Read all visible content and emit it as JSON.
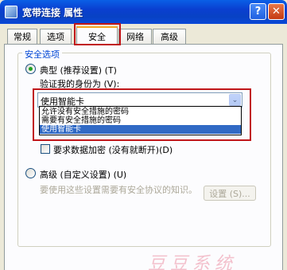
{
  "window": {
    "title": "宽带连接 属性",
    "help_glyph": "?",
    "close_glyph": "✕"
  },
  "tabs": [
    {
      "label": "常规"
    },
    {
      "label": "选项"
    },
    {
      "label": "安全"
    },
    {
      "label": "网络"
    },
    {
      "label": "高级"
    }
  ],
  "security": {
    "group_label": "安全选项",
    "typical_label": "典型 (推荐设置) (T)",
    "verify_label": "验证我的身份为 (V):",
    "combo_value": "使用智能卡",
    "combo_arrow": "⌄",
    "options": [
      "允许没有安全措施的密码",
      "需要有安全措施的密码",
      "使用智能卡"
    ],
    "encrypt_label": "要求数据加密 (没有就断开)(D)",
    "advanced_label": "高级 (自定义设置) (U)",
    "advanced_desc": "要使用这些设置需要有安全协议的知识。",
    "settings_button": "设置 (S)..."
  },
  "watermark": "豆豆系统",
  "colors": {
    "highlight_red": "#c0161a",
    "selection_blue": "#316ac5",
    "group_label": "#0046d5"
  }
}
